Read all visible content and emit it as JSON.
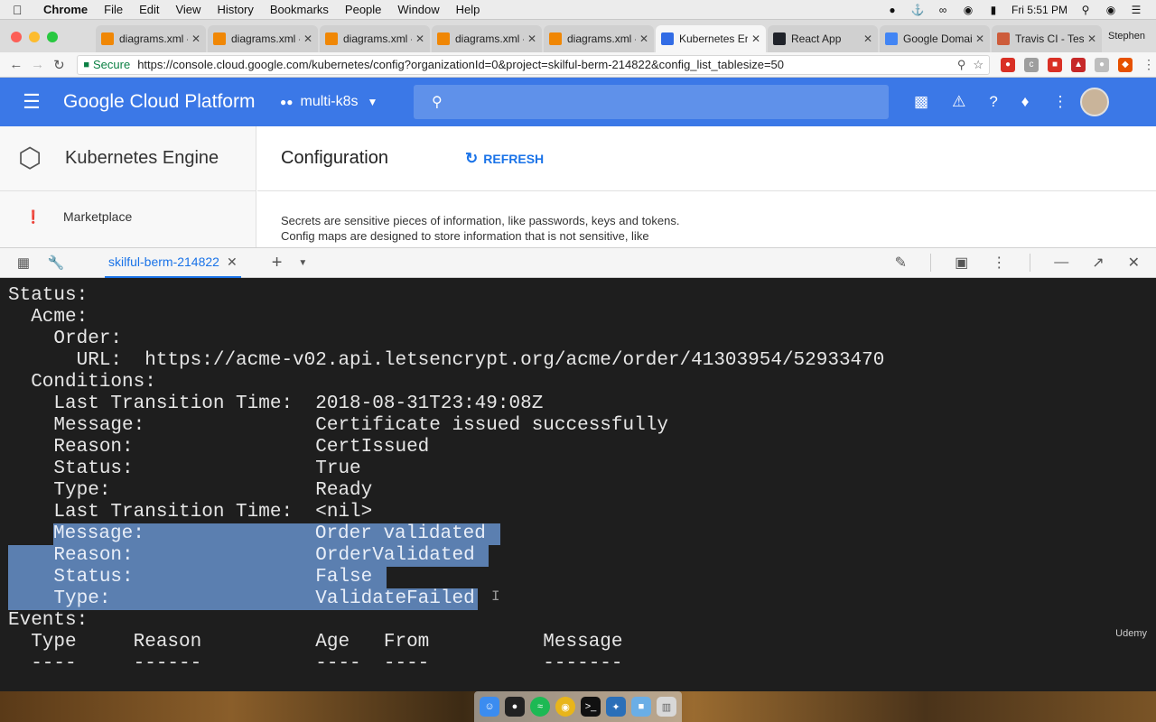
{
  "menubar": {
    "app": "Chrome",
    "items": [
      "File",
      "Edit",
      "View",
      "History",
      "Bookmarks",
      "People",
      "Window",
      "Help"
    ],
    "clock": "Fri 5:51 PM"
  },
  "tabs": [
    {
      "title": "diagrams.xml -",
      "favicon_color": "#f08705"
    },
    {
      "title": "diagrams.xml -",
      "favicon_color": "#f08705"
    },
    {
      "title": "diagrams.xml -",
      "favicon_color": "#f08705"
    },
    {
      "title": "diagrams.xml -",
      "favicon_color": "#f08705"
    },
    {
      "title": "diagrams.xml -",
      "favicon_color": "#f08705"
    },
    {
      "title": "Kubernetes Eng",
      "favicon_color": "#326ce5",
      "active": true
    },
    {
      "title": "React App",
      "favicon_color": "#20232a"
    },
    {
      "title": "Google Domain",
      "favicon_color": "#4285f4"
    },
    {
      "title": "Travis CI - Test",
      "favicon_color": "#cd5c3b"
    }
  ],
  "profile_name": "Stephen",
  "address": {
    "secure_label": "Secure",
    "url": "https://console.cloud.google.com/kubernetes/config?organizationId=0&project=skilful-berm-214822&config_list_tablesize=50"
  },
  "gcp": {
    "brand": "Google Cloud Platform",
    "project": "multi-k8s",
    "accent": "#3b78e7"
  },
  "sidebar": {
    "product": "Kubernetes Engine",
    "item": "Marketplace"
  },
  "page": {
    "title": "Configuration",
    "refresh": "REFRESH",
    "desc_line1": "Secrets are sensitive pieces of information, like passwords, keys and tokens.",
    "desc_line2": "Config maps are designed to store information that is not sensitive, like"
  },
  "shell": {
    "tab": "skilful-berm-214822"
  },
  "terminal": {
    "lines": [
      "Status:",
      "  Acme:",
      "    Order:",
      "      URL:  https://acme-v02.api.letsencrypt.org/acme/order/41303954/52933470",
      "  Conditions:",
      "    Last Transition Time:  2018-08-31T23:49:08Z",
      "    Message:               Certificate issued successfully",
      "    Reason:                CertIssued",
      "    Status:                True",
      "    Type:                  Ready",
      "    Last Transition Time:  <nil>",
      "    Message:               Order validated",
      "    Reason:                OrderValidated",
      "    Status:                False",
      "    Type:                  ValidateFailed",
      "Events:",
      "  Type     Reason          Age   From          Message",
      "  ----     ------          ----  ----          -------"
    ]
  },
  "watermark": "Udemy"
}
